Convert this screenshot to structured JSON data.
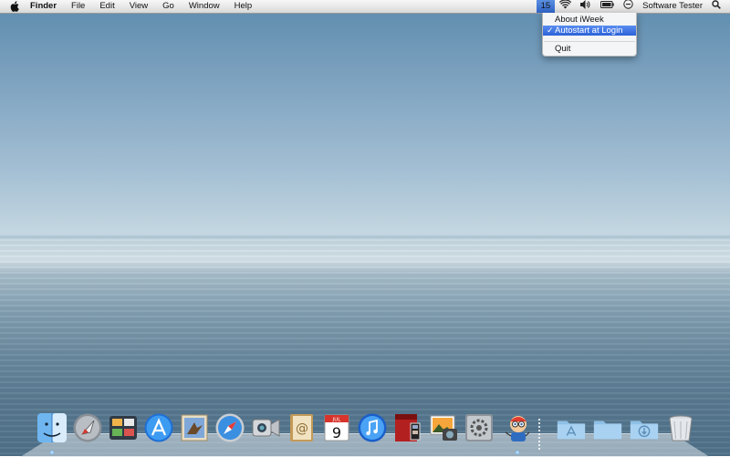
{
  "menubar": {
    "app_name": "Finder",
    "items": [
      "File",
      "Edit",
      "View",
      "Go",
      "Window",
      "Help"
    ],
    "status": {
      "iweek_text": "15",
      "user_name": "Software Tester"
    }
  },
  "iweek_menu": {
    "items": [
      {
        "label": "About iWeek",
        "checked": false,
        "highlighted": false
      },
      {
        "label": "Autostart at Login",
        "checked": true,
        "highlighted": true
      },
      {
        "label": "Quit",
        "checked": false,
        "highlighted": false
      }
    ],
    "checkmark": "✓"
  },
  "dock": {
    "icons": [
      {
        "name": "finder-icon",
        "running": true
      },
      {
        "name": "launchpad-icon",
        "running": false
      },
      {
        "name": "mission-control-icon",
        "running": false
      },
      {
        "name": "app-store-icon",
        "running": false
      },
      {
        "name": "mail-icon",
        "running": false
      },
      {
        "name": "safari-icon",
        "running": false
      },
      {
        "name": "facetime-icon",
        "running": false
      },
      {
        "name": "address-book-icon",
        "running": false
      },
      {
        "name": "ical-icon",
        "running": false
      },
      {
        "name": "itunes-icon",
        "running": false
      },
      {
        "name": "photo-booth-icon",
        "running": false
      },
      {
        "name": "iphoto-icon",
        "running": false
      },
      {
        "name": "system-preferences-icon",
        "running": false
      },
      {
        "name": "iweek-app-icon",
        "running": true
      },
      {
        "name": "applications-folder-icon",
        "running": false
      },
      {
        "name": "documents-folder-icon",
        "running": false
      },
      {
        "name": "downloads-folder-icon",
        "running": false
      },
      {
        "name": "trash-icon",
        "running": false
      }
    ],
    "calendar_day": "9",
    "calendar_month": "JUL"
  }
}
